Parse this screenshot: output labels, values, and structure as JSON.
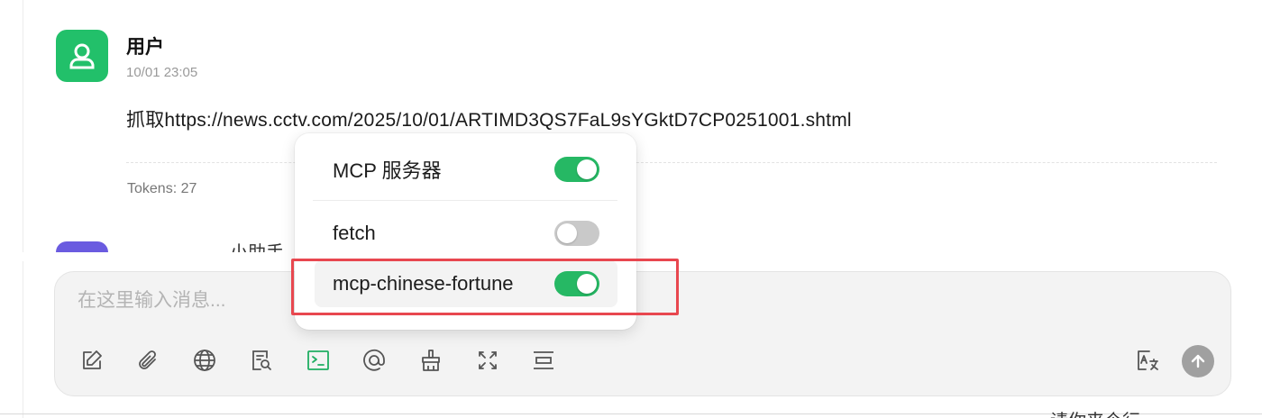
{
  "message": {
    "sender": "用户",
    "time": "10/01 23:05",
    "text": "抓取https://news.cctv.com/2025/10/01/ARTIMD3QS7FaL9sYGktD7CP0251001.shtml",
    "tokens": "Tokens: 27"
  },
  "next_message": {
    "name_fragment": "小助手"
  },
  "input": {
    "placeholder": "在这里输入消息..."
  },
  "toolbar": {
    "tools": [
      "edit-icon",
      "attachment-icon",
      "globe-icon",
      "knowledge-search-icon",
      "terminal-icon",
      "at-icon",
      "clean-icon",
      "fullscreen-icon",
      "more-icon"
    ],
    "right_tools": [
      "translate-icon",
      "send-icon"
    ],
    "active_tool": "terminal-icon"
  },
  "mcp_popup": {
    "header": {
      "label": "MCP 服务器",
      "enabled": true
    },
    "servers": [
      {
        "label": "fetch",
        "enabled": false
      },
      {
        "label": "mcp-chinese-fortune",
        "enabled": true
      }
    ],
    "highlighted": "mcp-chinese-fortune"
  },
  "bottom": {
    "fragment": "请你来个行"
  },
  "colors": {
    "avatar": "#22c06a",
    "next_avatar": "#6a5be0",
    "toggle_on": "#26b864",
    "toggle_off": "#c9c9c9",
    "active_tool": "#1fae62",
    "highlight": "#e8474f",
    "send_button": "#a0a0a0"
  }
}
